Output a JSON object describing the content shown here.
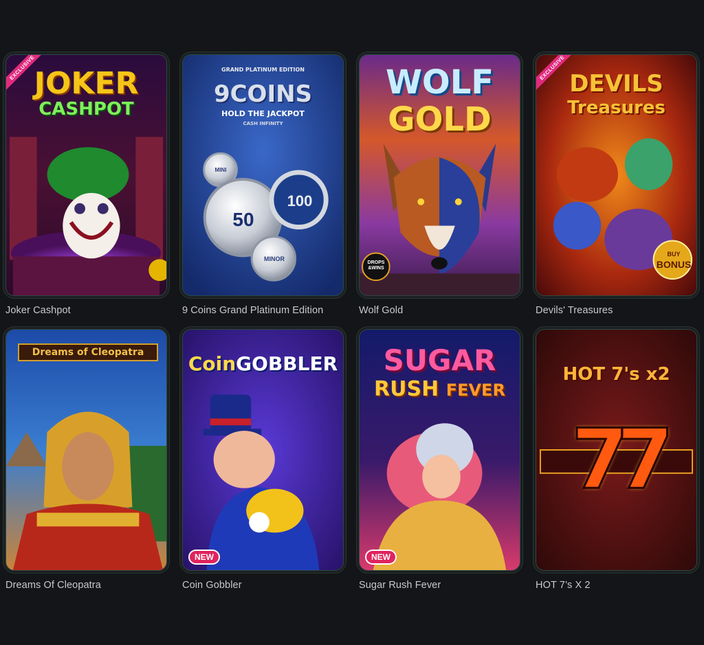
{
  "games": [
    {
      "title": "Joker Cashpot",
      "logo_line1": "JOKER",
      "logo_line2": "CASHPOT",
      "ribbon": "EXCLUSIVE",
      "badge": ""
    },
    {
      "title": "9 Coins Grand Platinum Edition",
      "logo_top": "GRAND PLATINUM EDITION",
      "logo_line1": "9COINS",
      "logo_line2": "HOLD THE JACKPOT",
      "logo_line3": "CASH INFINITY",
      "coin_mini": "MINI",
      "coin_50": "50",
      "coin_100": "100",
      "coin_minor": "MINOR",
      "ribbon": "",
      "badge": ""
    },
    {
      "title": "Wolf Gold",
      "logo_line1": "WOLF",
      "logo_line2": "GOLD",
      "drops_badge": "DROPS &WINS",
      "ribbon": "",
      "badge": ""
    },
    {
      "title": "Devils' Treasures",
      "logo_line1": "DEVILS",
      "logo_line2": "Treasures",
      "bonus_line1": "BUY",
      "bonus_line2": "BONUS",
      "ribbon": "EXCLUSIVE",
      "badge": ""
    },
    {
      "title": "Dreams Of Cleopatra",
      "logo_line1": "Dreams of Cleopatra",
      "ribbon": "",
      "badge": ""
    },
    {
      "title": "Coin Gobbler",
      "logo_line1": "Coin",
      "logo_line2": "GOBBLER",
      "ribbon": "",
      "badge": "NEW"
    },
    {
      "title": "Sugar Rush Fever",
      "logo_line1": "SUGAR",
      "logo_line2": "RUSH",
      "logo_line3": "FEVER",
      "ribbon": "",
      "badge": "NEW"
    },
    {
      "title": "HOT 7’s X 2",
      "logo_line1": "HOT 7's x2",
      "big_digits": "77",
      "ribbon": "",
      "badge": ""
    }
  ],
  "colors": {
    "background": "#141518",
    "title_text": "#c7c9ce",
    "card_border": "#2b4a40",
    "new_badge": "#e0245e",
    "exclusive_ribbon": "#e22a7d"
  },
  "icons": [
    "joker-art",
    "coins-art",
    "wolf-art",
    "devils-art",
    "cleopatra-art",
    "gobbler-art",
    "sugar-rush-art",
    "hot-sevens-art"
  ]
}
